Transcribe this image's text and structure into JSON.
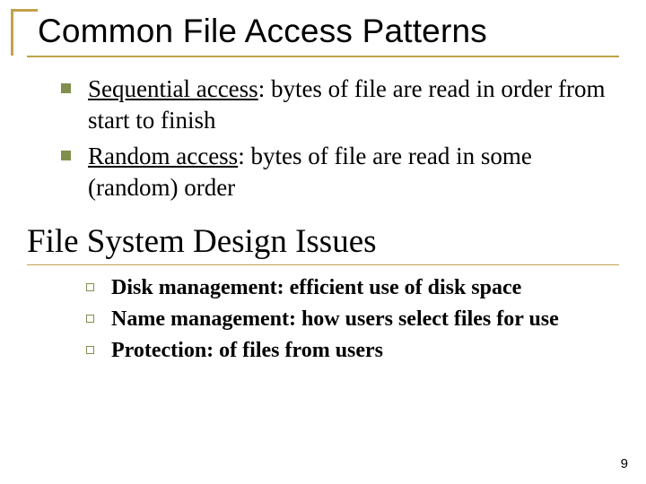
{
  "title": "Common File Access Patterns",
  "bullets1": [
    {
      "term": "Sequential access",
      "text": ": bytes of file are read in order from start to finish"
    },
    {
      "term": "Random access",
      "text": ": bytes of file are read in some (random) order"
    }
  ],
  "section": "File System Design Issues",
  "bullets2": [
    "Disk management: efficient use of disk space",
    "Name management: how users select files for use",
    "Protection: of files from users"
  ],
  "pagenum": "9"
}
